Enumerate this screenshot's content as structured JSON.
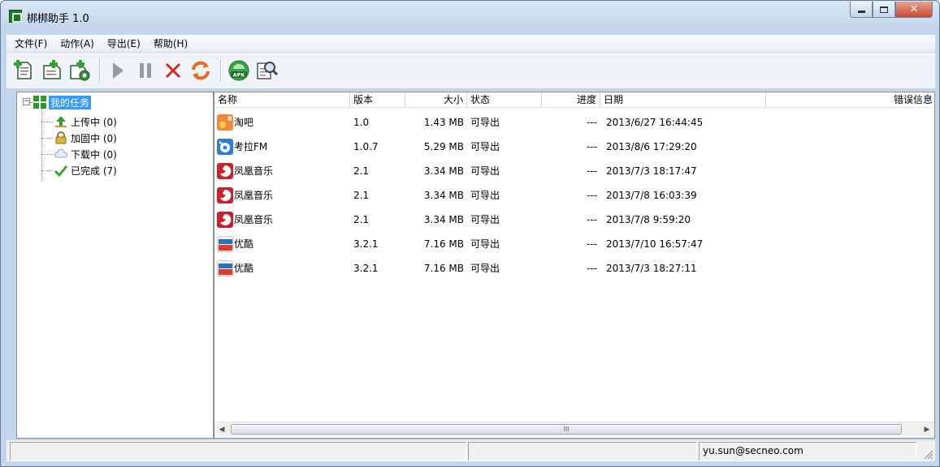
{
  "window": {
    "title": "梆梆助手 1.0"
  },
  "menu": [
    {
      "id": "file",
      "label": "文件(F)"
    },
    {
      "id": "action",
      "label": "动作(A)"
    },
    {
      "id": "export",
      "label": "导出(E)"
    },
    {
      "id": "help",
      "label": "帮助(H)"
    }
  ],
  "toolbar": {
    "buttons": [
      "add-task-icon",
      "add-file-icon",
      "add-folder-icon",
      "play-icon",
      "pause-icon",
      "delete-icon",
      "refresh-icon",
      "apk-icon",
      "search-document-icon"
    ]
  },
  "tree": {
    "root": "我的任务",
    "items": [
      {
        "label": "上传中 (0)",
        "icon": "upload-icon"
      },
      {
        "label": "加固中 (0)",
        "icon": "lock-icon"
      },
      {
        "label": "下载中 (0)",
        "icon": "cloud-download-icon"
      },
      {
        "label": "已完成 (7)",
        "icon": "checkmark-icon"
      }
    ]
  },
  "table": {
    "columns": [
      "名称",
      "版本",
      "大小",
      "状态",
      "进度",
      "日期",
      "错误信息"
    ],
    "rows": [
      {
        "name": "淘吧",
        "version": "1.0",
        "size": "1.43 MB",
        "status": "可导出",
        "progress": "---",
        "date": "2013/6/27 16:44:45",
        "icon": "taoba-app-icon"
      },
      {
        "name": "考拉FM",
        "version": "1.0.7",
        "size": "5.29 MB",
        "status": "可导出",
        "progress": "---",
        "date": "2013/8/6 17:29:20",
        "icon": "koala-fm-app-icon"
      },
      {
        "name": "凤凰音乐",
        "version": "2.1",
        "size": "3.34 MB",
        "status": "可导出",
        "progress": "---",
        "date": "2013/7/3 18:17:47",
        "icon": "phoenix-music-app-icon"
      },
      {
        "name": "凤凰音乐",
        "version": "2.1",
        "size": "3.34 MB",
        "status": "可导出",
        "progress": "---",
        "date": "2013/7/8 16:03:39",
        "icon": "phoenix-music-app-icon"
      },
      {
        "name": "凤凰音乐",
        "version": "2.1",
        "size": "3.34 MB",
        "status": "可导出",
        "progress": "---",
        "date": "2013/7/8 9:59:20",
        "icon": "phoenix-music-app-icon"
      },
      {
        "name": "优酷",
        "version": "3.2.1",
        "size": "7.16 MB",
        "status": "可导出",
        "progress": "---",
        "date": "2013/7/10 16:57:47",
        "icon": "youku-app-icon"
      },
      {
        "name": "优酷",
        "version": "3.2.1",
        "size": "7.16 MB",
        "status": "可导出",
        "progress": "---",
        "date": "2013/7/3 18:27:11",
        "icon": "youku-app-icon"
      }
    ]
  },
  "scrollbar": {
    "thumb_glyph": "III"
  },
  "status": {
    "email": "yu.sun@secneo.com"
  },
  "colors": {
    "selection": "#3399ff",
    "title_gradient_top": "#d9e6f4",
    "close_button": "#c74a33"
  }
}
